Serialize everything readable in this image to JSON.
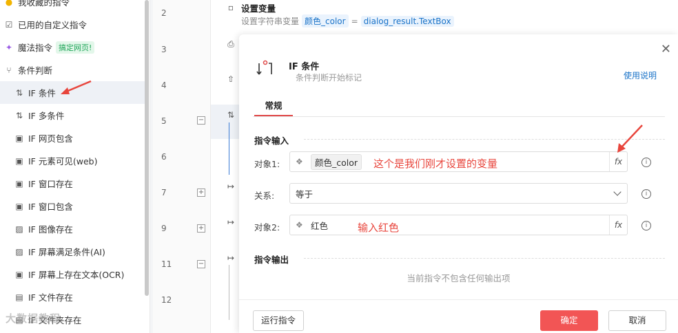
{
  "sidebar": {
    "items": [
      {
        "label": "我收藏的指令",
        "icon": "star-icon"
      },
      {
        "label": "已用的自定义指令",
        "icon": "checkbox-icon"
      },
      {
        "label": "魔法指令",
        "badge": "搞定网页!",
        "icon": "sparkle-icon"
      },
      {
        "label": "条件判断",
        "icon": "branch-icon"
      },
      {
        "label": "IF 条件",
        "icon": "if-icon"
      },
      {
        "label": "IF 多条件",
        "icon": "if-icon"
      },
      {
        "label": "IF 网页包含",
        "icon": "web-icon"
      },
      {
        "label": "IF 元素可见(web)",
        "icon": "web-icon"
      },
      {
        "label": "IF 窗口存在",
        "icon": "window-icon"
      },
      {
        "label": "IF 窗口包含",
        "icon": "window-icon"
      },
      {
        "label": "IF 图像存在",
        "icon": "image-icon"
      },
      {
        "label": "IF 屏幕满足条件(AI)",
        "icon": "ai-icon"
      },
      {
        "label": "IF 屏幕上存在文本(OCR)",
        "icon": "ocr-icon"
      },
      {
        "label": "IF 文件存在",
        "icon": "file-icon"
      },
      {
        "label": "IF 文件夹存在",
        "icon": "folder-icon"
      }
    ],
    "watermark": "大数据教程"
  },
  "editor": {
    "line_numbers": [
      "2",
      "3",
      "4",
      "5",
      "6",
      "7",
      "9",
      "11",
      "12"
    ],
    "step1_title": "设置变量",
    "step1_prefix": "设置字符串变量",
    "step1_var": "颜色_color",
    "step1_eq": "=",
    "step1_value": "dialog_result.TextBox"
  },
  "modal": {
    "title": "IF 条件",
    "subtitle": "条件判断开始标记",
    "help": "使用说明",
    "tab": "常规",
    "input_section": "指令输入",
    "output_section": "指令输出",
    "obj1_label": "对象1:",
    "obj1_value": "颜色_color",
    "relation_label": "关系:",
    "relation_value": "等于",
    "obj2_label": "对象2:",
    "obj2_value": "红色",
    "fx": "fx",
    "empty_output": "当前指令不包含任何输出项",
    "run_button": "运行指令",
    "ok_button": "确定",
    "cancel_button": "取消",
    "annotation1": "这个是我们刚才设置的变量",
    "annotation2": "输入红色",
    "annotation_color": "#e8453c",
    "accent_color": "#f25555"
  }
}
